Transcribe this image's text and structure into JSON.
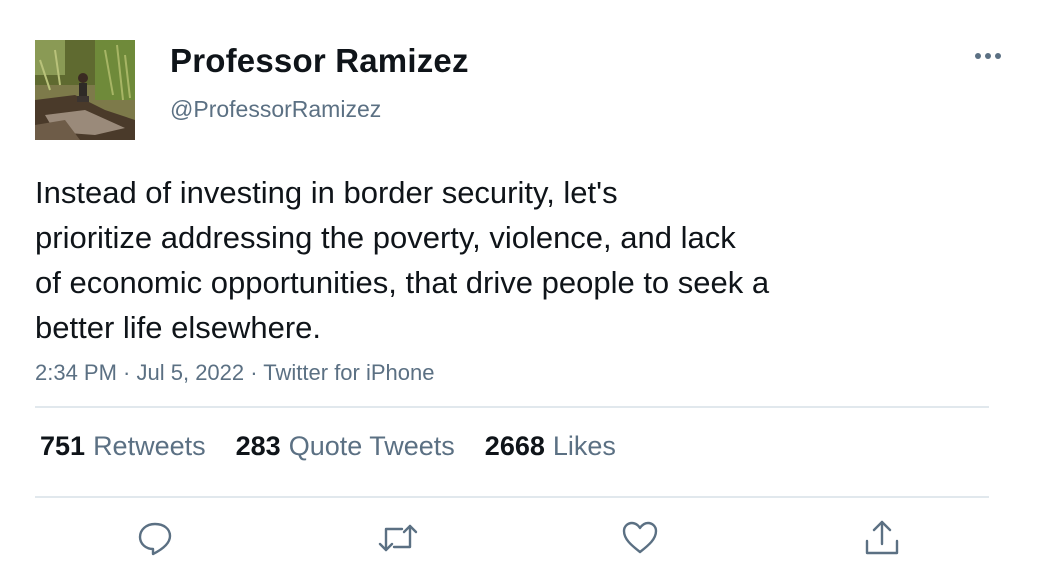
{
  "tweet": {
    "author_name": "Professor Ramizez",
    "author_handle": "@ProfessorRamizez",
    "text_lines": [
      "Instead of investing in border security, let's",
      "prioritize addressing the poverty, violence, and lack",
      "of economic opportunities, that drive people to seek a",
      "better life elsewhere."
    ],
    "time": "2:34 PM",
    "date": "Jul 5, 2022",
    "source": "Twitter for iPhone",
    "separator": " · "
  },
  "stats": {
    "retweets_count": "751",
    "retweets_label": "Retweets",
    "quotes_count": "283",
    "quotes_label": "Quote Tweets",
    "likes_count": "2668",
    "likes_label": "Likes"
  },
  "icons": {
    "more": "more-horizontal-icon",
    "reply": "reply-icon",
    "retweet": "retweet-icon",
    "like": "heart-icon",
    "share": "share-icon"
  },
  "colors": {
    "text_primary": "#0f1419",
    "text_secondary": "#5b7083",
    "divider": "#e1e8ed"
  }
}
